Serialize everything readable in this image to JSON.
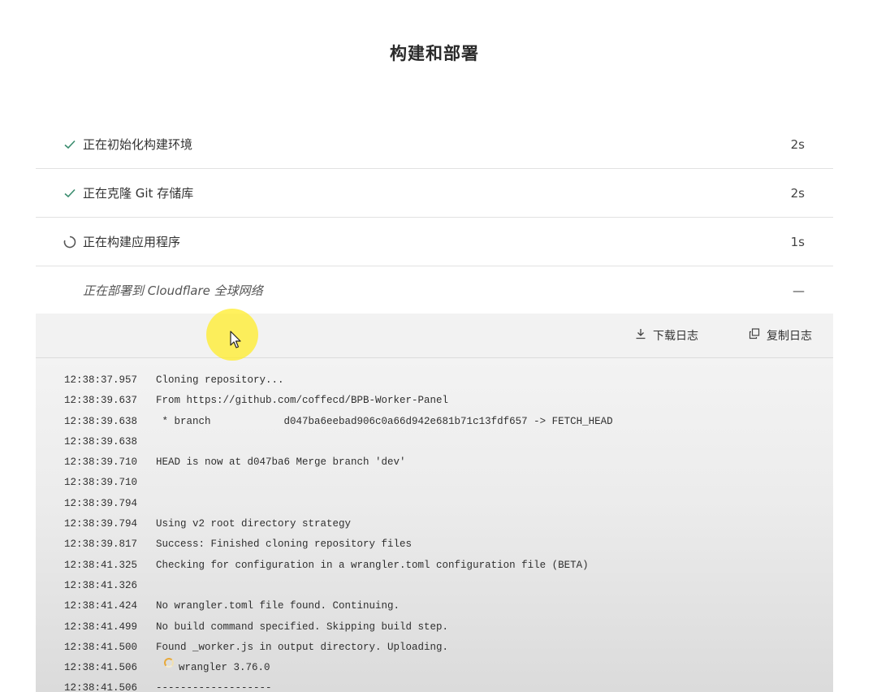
{
  "page": {
    "title": "构建和部署"
  },
  "steps": [
    {
      "label": "正在初始化构建环境",
      "status": "done",
      "duration": "2s"
    },
    {
      "label": "正在克隆 Git 存储库",
      "status": "done",
      "duration": "2s"
    },
    {
      "label": "正在构建应用程序",
      "status": "running",
      "duration": "1s"
    },
    {
      "label": "正在部署到 Cloudflare 全球网络",
      "status": "pending",
      "duration": "—"
    }
  ],
  "log_toolbar": {
    "download_label": "下载日志",
    "copy_label": "复制日志"
  },
  "log_lines": [
    {
      "time": "12:38:37.957",
      "msg": "Cloning repository..."
    },
    {
      "time": "12:38:39.637",
      "msg": "From https://github.com/coffecd/BPB-Worker-Panel"
    },
    {
      "time": "12:38:39.638",
      "msg": " * branch            d047ba6eebad906c0a66d942e681b71c13fdf657 -> FETCH_HEAD"
    },
    {
      "time": "12:38:39.638",
      "msg": ""
    },
    {
      "time": "12:38:39.710",
      "msg": "HEAD is now at d047ba6 Merge branch 'dev'"
    },
    {
      "time": "12:38:39.710",
      "msg": ""
    },
    {
      "time": "12:38:39.794",
      "msg": ""
    },
    {
      "time": "12:38:39.794",
      "msg": "Using v2 root directory strategy"
    },
    {
      "time": "12:38:39.817",
      "msg": "Success: Finished cloning repository files"
    },
    {
      "time": "12:38:41.325",
      "msg": "Checking for configuration in a wrangler.toml configuration file (BETA)"
    },
    {
      "time": "12:38:41.326",
      "msg": ""
    },
    {
      "time": "12:38:41.424",
      "msg": "No wrangler.toml file found. Continuing."
    },
    {
      "time": "12:38:41.499",
      "msg": "No build command specified. Skipping build step."
    },
    {
      "time": "12:38:41.500",
      "msg": "Found _worker.js in output directory. Uploading."
    },
    {
      "time": "12:38:41.506",
      "msg": "wrangler 3.76.0",
      "icon": "wrangler-spinner-icon"
    },
    {
      "time": "12:38:41.506",
      "msg": "-------------------"
    }
  ],
  "colors": {
    "check": "#3a8c6e",
    "spinner": "#555555",
    "log_bg": "#efefef",
    "highlight": "#ffec28"
  }
}
